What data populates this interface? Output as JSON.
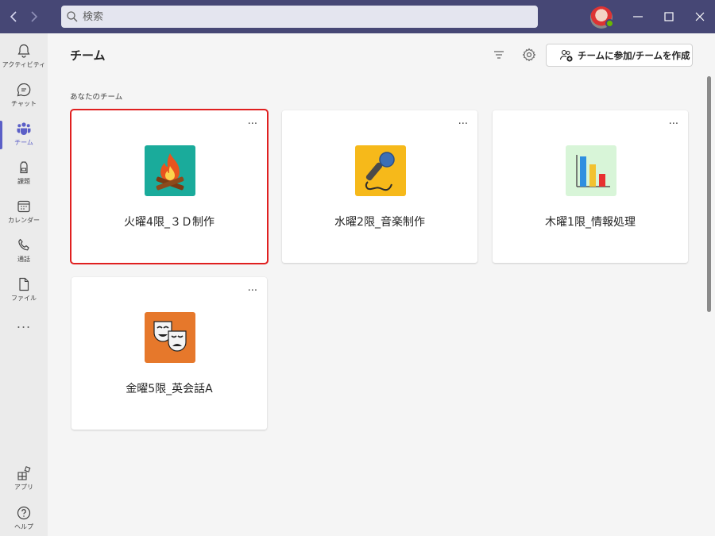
{
  "search": {
    "placeholder": "検索"
  },
  "rail": {
    "items": [
      {
        "label": "アクティビティ",
        "icon": "bell-icon"
      },
      {
        "label": "チャット",
        "icon": "chat-icon"
      },
      {
        "label": "チーム",
        "icon": "teams-icon"
      },
      {
        "label": "課題",
        "icon": "backpack-icon"
      },
      {
        "label": "カレンダー",
        "icon": "calendar-icon"
      },
      {
        "label": "通話",
        "icon": "phone-icon"
      },
      {
        "label": "ファイル",
        "icon": "file-icon"
      }
    ],
    "more": "...",
    "bottom": [
      {
        "label": "アプリ",
        "icon": "apps-icon"
      },
      {
        "label": "ヘルプ",
        "icon": "help-icon"
      }
    ]
  },
  "header": {
    "title": "チーム",
    "join_button": "チームに参加/チームを作成"
  },
  "section_label": "あなたのチーム",
  "teams": [
    {
      "name": "火曜4限_３Ｄ制作",
      "icon": "campfire-icon",
      "color": "#1aab9b",
      "selected": true
    },
    {
      "name": "水曜2限_音楽制作",
      "icon": "microphone-icon",
      "color": "#f6b91a",
      "selected": false
    },
    {
      "name": "木曜1限_情報処理",
      "icon": "bar-chart-icon",
      "color": "#d8f5d8",
      "selected": false
    },
    {
      "name": "金曜5限_英会話A",
      "icon": "theater-masks-icon",
      "color": "#e6782b",
      "selected": false
    }
  ],
  "card_more": "...",
  "colors": {
    "titlebar": "#464775",
    "accent": "#5b5fc7",
    "selection": "#e02020"
  }
}
